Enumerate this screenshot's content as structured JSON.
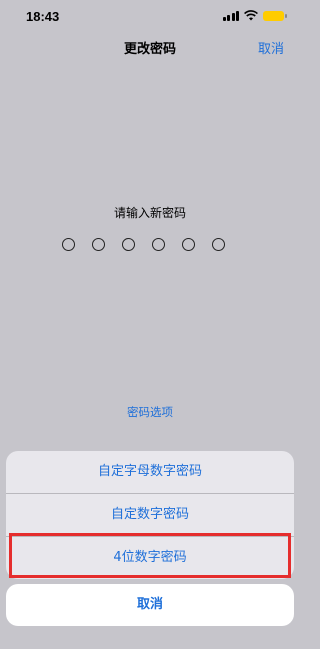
{
  "status_bar": {
    "time": "18:43"
  },
  "nav": {
    "title": "更改密码",
    "cancel_label": "取消"
  },
  "passcode": {
    "prompt": "请输入新密码",
    "digits": 6
  },
  "options_link": "密码选项",
  "sheet": {
    "items": [
      {
        "label": "自定字母数字密码"
      },
      {
        "label": "自定数字密码"
      },
      {
        "label": "4位数字密码"
      }
    ],
    "cancel_label": "取消"
  },
  "colors": {
    "accent": "#1e6fd9",
    "highlight": "#e52d2d",
    "battery": "#ffcc00"
  }
}
